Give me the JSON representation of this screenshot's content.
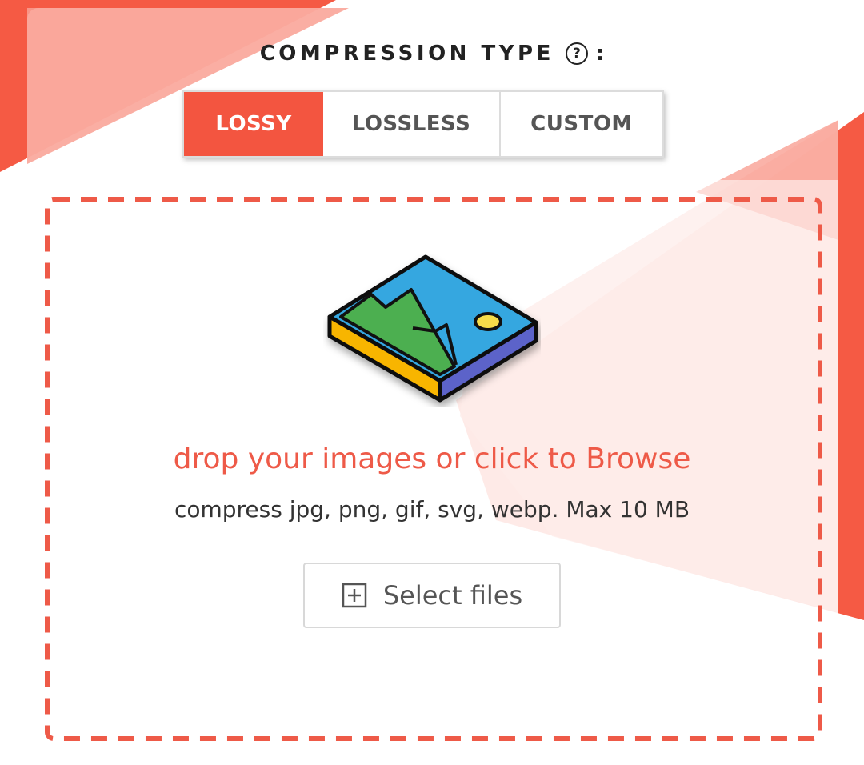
{
  "compression": {
    "title": "COMPRESSION TYPE",
    "help_glyph": "?",
    "colon": ":",
    "options": [
      {
        "label": "LOSSY",
        "active": true
      },
      {
        "label": "LOSSLESS",
        "active": false
      },
      {
        "label": "CUSTOM",
        "active": false
      }
    ]
  },
  "upload": {
    "prompt": "drop your images or click to Browse",
    "formats": "compress jpg, png, gif, svg, webp. Max 10 MB",
    "select_label": "Select files",
    "icons": {
      "illustration": "image-upload-illustration",
      "select": "plus-square-icon",
      "help": "question-circle-icon"
    }
  },
  "colors": {
    "accent": "#f35540",
    "dropzone_border": "#ee5a48",
    "prompt_text": "#ee5a48"
  }
}
